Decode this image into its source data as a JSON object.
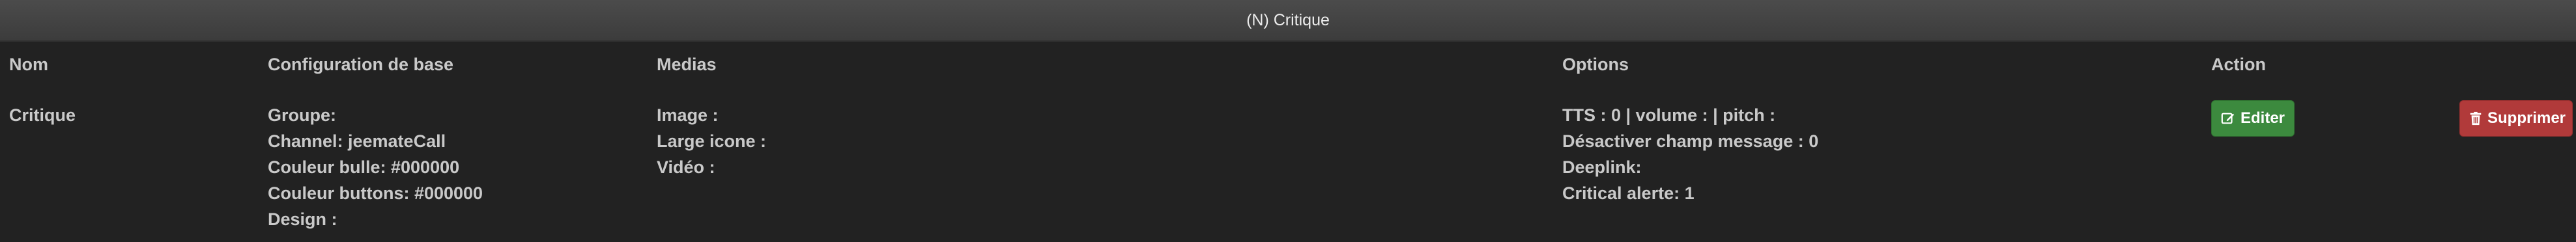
{
  "panel": {
    "title": "(N) Critique"
  },
  "columns": {
    "nom": "Nom",
    "config": "Configuration de base",
    "medias": "Medias",
    "options": "Options",
    "action": "Action"
  },
  "row": {
    "name": "Critique",
    "config": [
      "Groupe:",
      "Channel: jeemateCall",
      "Couleur bulle: #000000",
      "Couleur buttons: #000000",
      "Design :"
    ],
    "medias": [
      "Image :",
      "Large icone :",
      "Vidéo :"
    ],
    "options": [
      "TTS : 0 | volume : | pitch :",
      "Désactiver champ message : 0",
      "Deeplink:",
      "Critical alerte: 1"
    ],
    "actions": {
      "edit_label": "Editer",
      "delete_label": "Supprimer",
      "edit_icon": "edit-icon",
      "delete_icon": "trash-icon"
    }
  },
  "colors": {
    "background": "#222222",
    "header": "#444444",
    "edit": "#3c8a3e",
    "delete": "#b13a3a"
  }
}
